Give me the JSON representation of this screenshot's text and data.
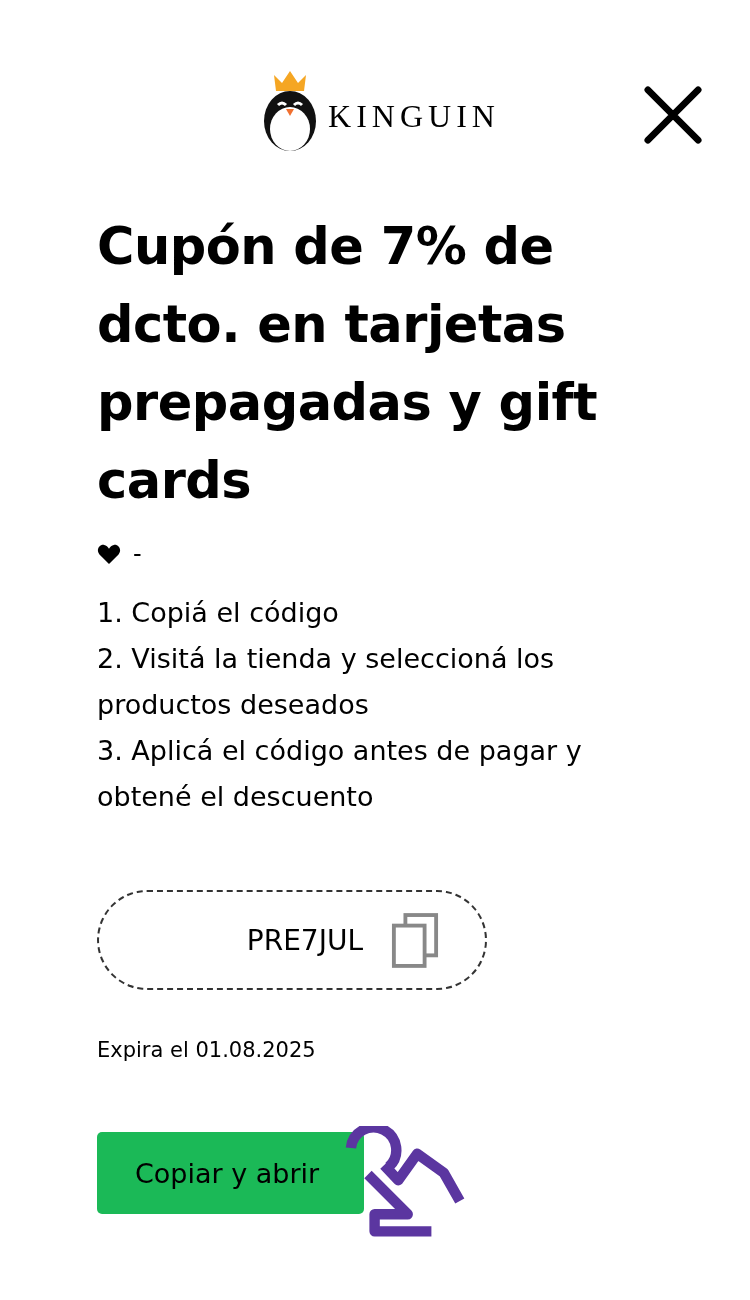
{
  "logo": {
    "text": "KINGUIN"
  },
  "title": "Cupón de 7% de dcto. en tarjetas prepagadas y gift cards",
  "meta": {
    "text": "-"
  },
  "steps": [
    "1. Copiá el código",
    "2. Visitá la tienda y seleccioná los productos deseados",
    "3. Aplicá el código antes de pagar y obtené el descuento"
  ],
  "coupon": {
    "code": "PRE7JUL"
  },
  "expiry": "Expira el 01.08.2025",
  "button": {
    "label": "Copiar y abrir"
  }
}
